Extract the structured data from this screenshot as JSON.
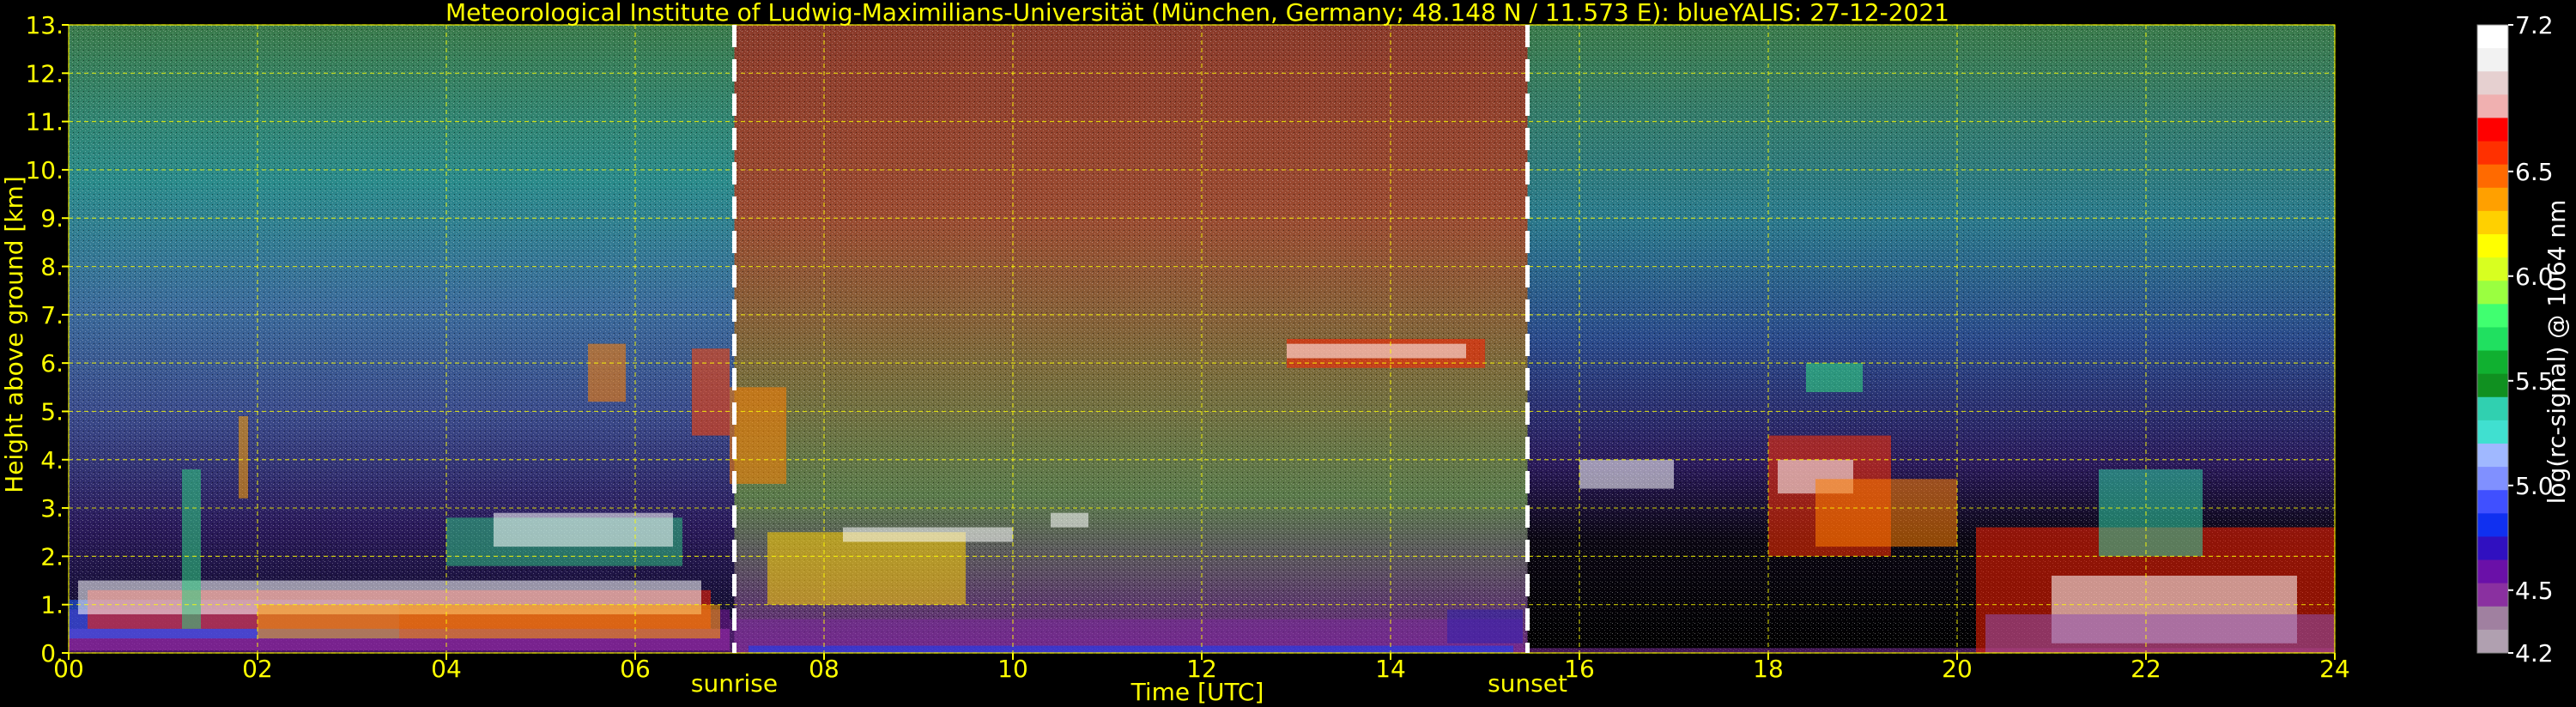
{
  "chart_data": {
    "type": "heatmap",
    "title": "Meteorological Institute of Ludwig-Maximilians-Universität (München, Germany; 48.148 N / 11.573 E):    blueYALIS: 27-12-2021",
    "xlabel": "Time [UTC]",
    "ylabel": "Height above ground [km]",
    "xlim": [
      0,
      24
    ],
    "ylim": [
      0,
      13
    ],
    "x_ticks": [
      "00",
      "02",
      "04",
      "06",
      "08",
      "10",
      "12",
      "14",
      "16",
      "18",
      "20",
      "22",
      "24"
    ],
    "y_ticks": [
      "0.",
      "1.",
      "2.",
      "3.",
      "4.",
      "5.",
      "6.",
      "7.",
      "8.",
      "9.",
      "10.",
      "11.",
      "12.",
      "13."
    ],
    "grid": true,
    "annotations": [
      {
        "label": "sunrise",
        "x": 7.05
      },
      {
        "label": "sunset",
        "x": 15.45
      }
    ],
    "colorbar": {
      "label": "log(rc-signal) @ 1064 nm",
      "range": [
        4.2,
        7.2
      ],
      "ticks": [
        "7.2",
        "6.5",
        "6.0",
        "5.5",
        "5.0",
        "4.5",
        "4.2"
      ],
      "colors": [
        "#ffffff",
        "#f2f2f2",
        "#e6d0d0",
        "#f0b0b0",
        "#ff0000",
        "#ff3000",
        "#ff6a00",
        "#ffa000",
        "#ffd000",
        "#ffff00",
        "#d8ff20",
        "#9aff40",
        "#40ff70",
        "#20e060",
        "#10b030",
        "#109020",
        "#30d0b0",
        "#40e0d0",
        "#a0b8ff",
        "#8090ff",
        "#4050ff",
        "#1030f0",
        "#3010c0",
        "#6a10a8",
        "#8a30a0",
        "#a080a0",
        "#b0a0b0"
      ]
    }
  }
}
